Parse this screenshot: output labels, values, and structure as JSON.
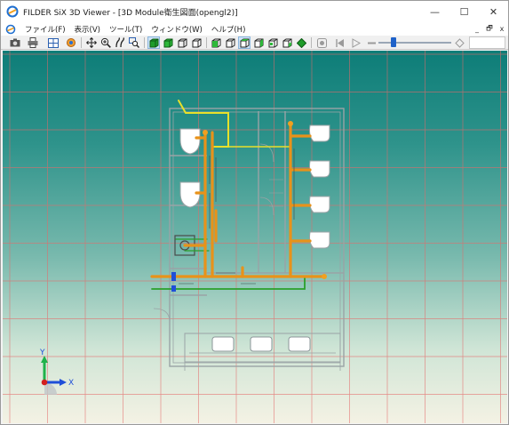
{
  "window": {
    "title": "FILDER SiX 3D Viewer - [3D Module衛生図面(opengl2)]",
    "controls": {
      "minimize": "—",
      "maximize": "☐",
      "close": "✕"
    }
  },
  "menu": {
    "items": [
      "ファイル(F)",
      "表示(V)",
      "ツール(T)",
      "ウィンドウ(W)",
      "ヘルプ(H)"
    ],
    "mdi_controls": {
      "minimize": "_",
      "restore": "🗗",
      "close": "x"
    }
  },
  "toolbar": {
    "buttons": [
      "camera-icon",
      "print-icon",
      "grid-view-icon",
      "measure-icon",
      "pan-icon",
      "zoom-in-icon",
      "walk-icon",
      "zoom-window-icon",
      "shade-solid-icon",
      "shade-green-icon",
      "wireframe-icon",
      "hidden-line-icon",
      "view-front-icon",
      "view-back-icon",
      "view-top-icon",
      "view-side-icon",
      "view-iso-icon",
      "view-right-icon",
      "view-green-icon",
      "record-icon",
      "skip-back-icon",
      "play-icon",
      "minus-icon",
      "plus-icon"
    ],
    "slider_position": 0.18
  },
  "viewport": {
    "axis_labels": {
      "x": "X",
      "y": "Y"
    },
    "colors": {
      "background_top": "#0d7d78",
      "background_bottom": "#f4f2e4",
      "grid": "#e46a6a",
      "pipe_orange": "#e8921a",
      "pipe_green": "#2aa02a",
      "pipe_yellow": "#e8e02a",
      "wall": "#9aa3a6",
      "fixture": "#ffffff",
      "axis_x": "#1f4fd8",
      "axis_y": "#1fb24a",
      "axis_z": "#d21f1f"
    }
  }
}
